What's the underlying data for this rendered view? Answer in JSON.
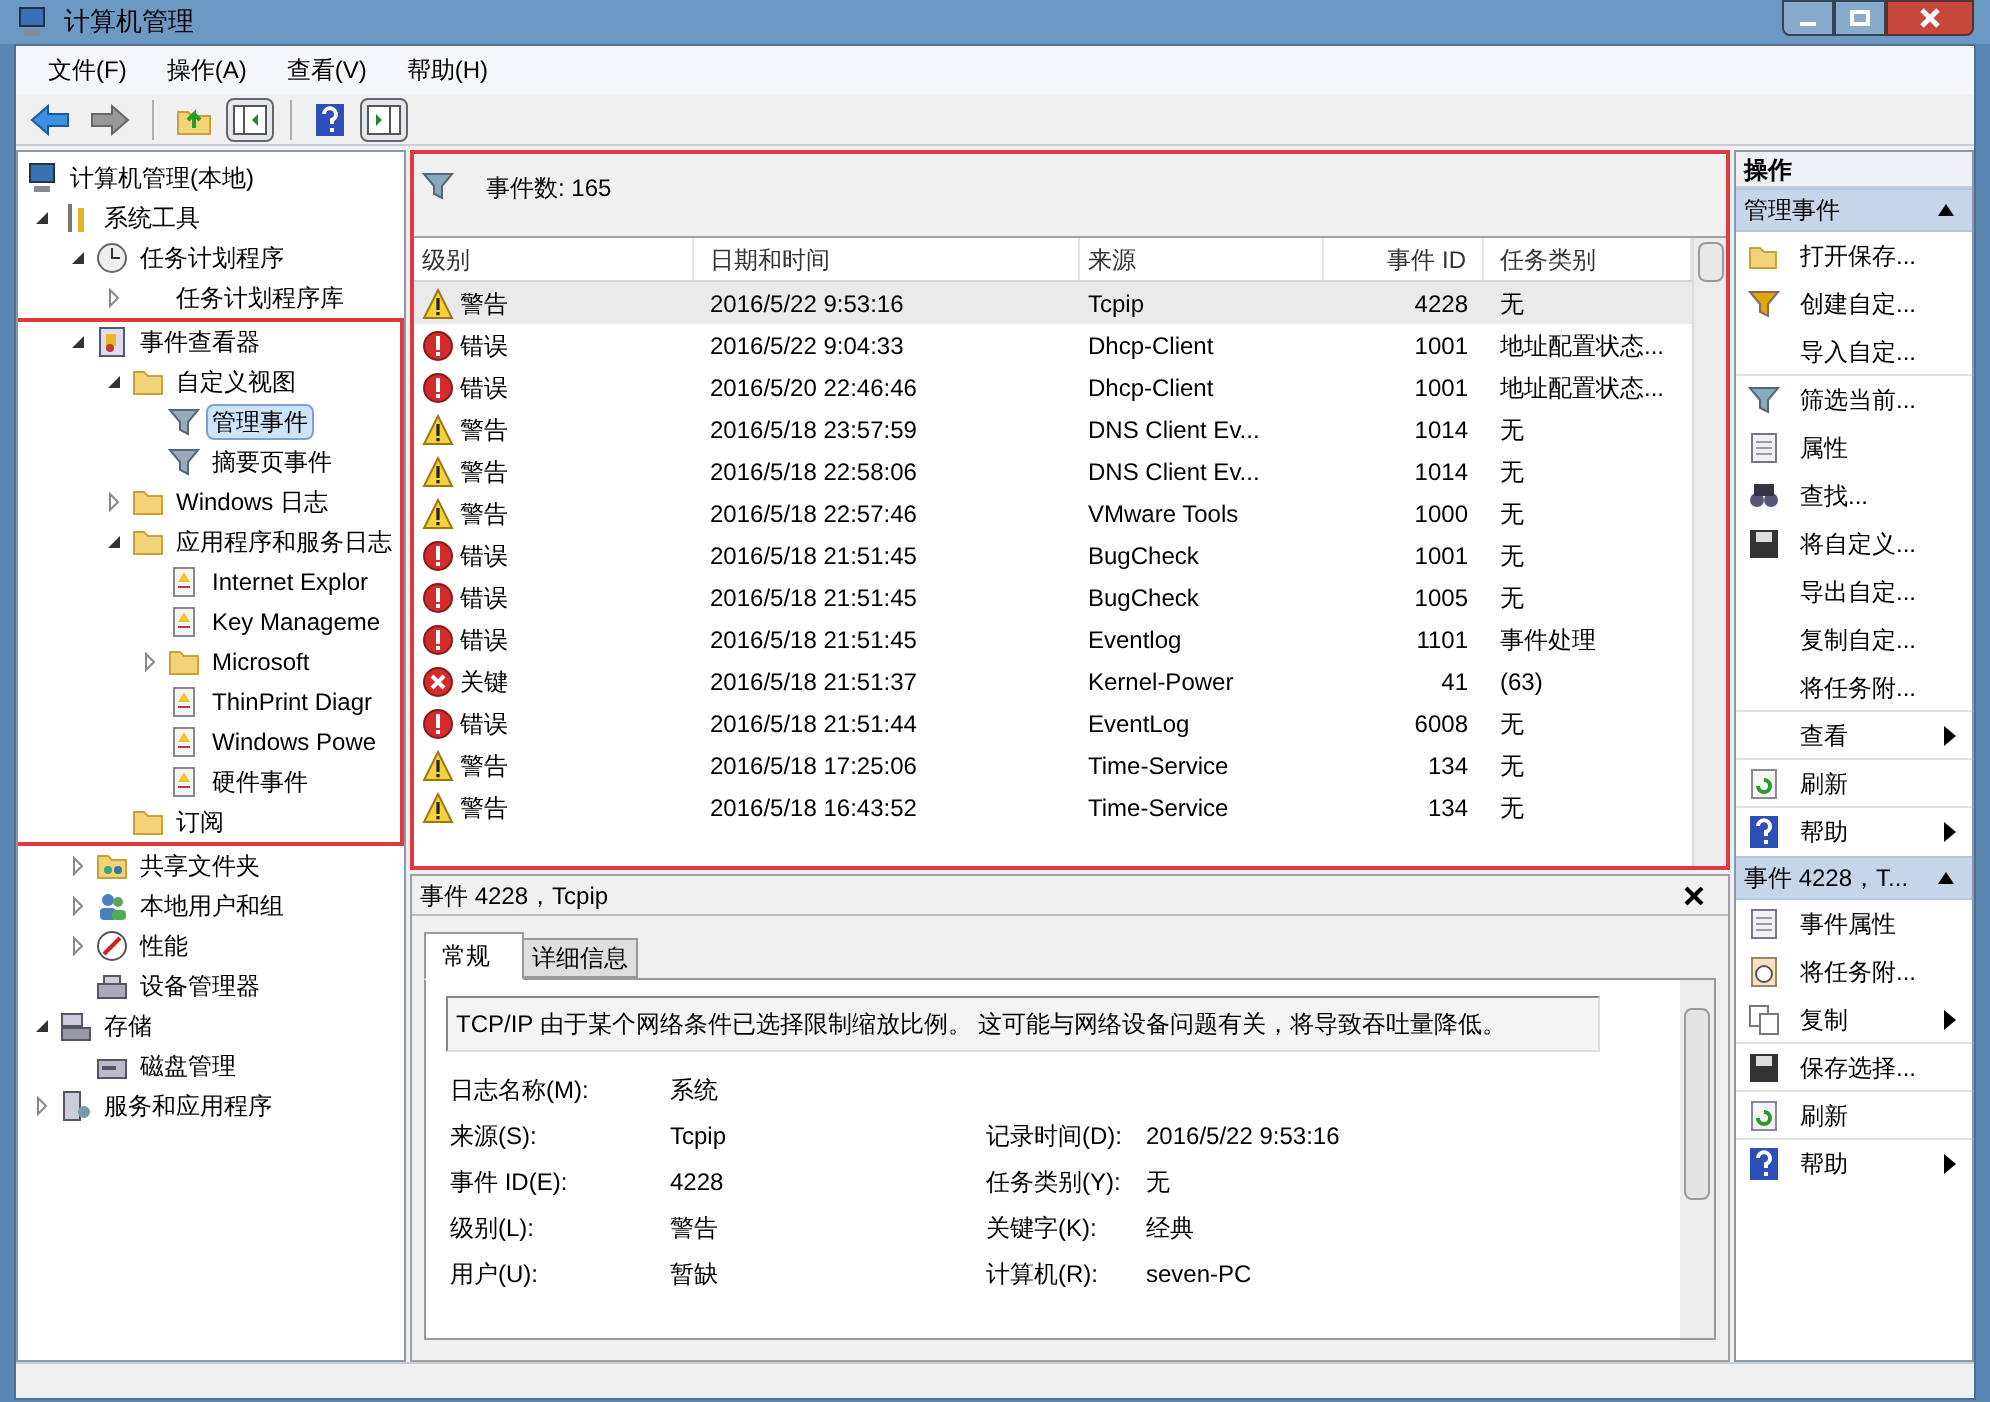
{
  "window": {
    "title": "计算机管理"
  },
  "menu": [
    "文件(F)",
    "操作(A)",
    "查看(V)",
    "帮助(H)"
  ],
  "toolbar": [
    {
      "kind": "back",
      "pressed": false
    },
    {
      "kind": "forward",
      "pressed": false
    },
    {
      "kind": "sep"
    },
    {
      "kind": "up",
      "pressed": false
    },
    {
      "kind": "tree",
      "pressed": true
    },
    {
      "kind": "sep"
    },
    {
      "kind": "help",
      "pressed": false
    },
    {
      "kind": "actions",
      "pressed": true
    }
  ],
  "tree": [
    {
      "label": "计算机管理(本地)",
      "kind": "computer",
      "selected": false,
      "children": [
        {
          "label": "系统工具",
          "kind": "tools",
          "expanded": true,
          "selected": false,
          "children": [
            {
              "label": "任务计划程序",
              "kind": "clock",
              "expanded": true,
              "selected": false,
              "children": [
                {
                  "label": "任务计划程序库",
                  "kind": "none",
                  "expanded": false,
                  "selected": false
                }
              ]
            },
            {
              "label": "事件查看器",
              "kind": "viewer",
              "expanded": true,
              "highlighted": true,
              "selected": false,
              "children": [
                {
                  "label": "自定义视图",
                  "kind": "folder",
                  "expanded": true,
                  "selected": false,
                  "children": [
                    {
                      "label": "管理事件",
                      "kind": "filter",
                      "selected": true
                    },
                    {
                      "label": "摘要页事件",
                      "kind": "filter",
                      "selected": false
                    }
                  ]
                },
                {
                  "label": "Windows 日志",
                  "kind": "folder",
                  "expanded": false,
                  "selected": false
                },
                {
                  "label": "应用程序和服务日志",
                  "kind": "folder",
                  "expanded": true,
                  "selected": false,
                  "children": [
                    {
                      "label": "Internet Explor",
                      "kind": "log",
                      "selected": false
                    },
                    {
                      "label": "Key Manageme",
                      "kind": "log",
                      "selected": false
                    },
                    {
                      "label": "Microsoft",
                      "kind": "folder",
                      "expanded": false,
                      "selected": false
                    },
                    {
                      "label": "ThinPrint Diagr",
                      "kind": "log",
                      "selected": false
                    },
                    {
                      "label": "Windows Powe",
                      "kind": "log",
                      "selected": false
                    },
                    {
                      "label": "硬件事件",
                      "kind": "log",
                      "selected": false
                    }
                  ]
                },
                {
                  "label": "订阅",
                  "kind": "folder",
                  "selected": false
                }
              ]
            },
            {
              "label": "共享文件夹",
              "kind": "share",
              "expanded": false,
              "selected": false
            },
            {
              "label": "本地用户和组",
              "kind": "users",
              "expanded": false,
              "selected": false
            },
            {
              "label": "性能",
              "kind": "perf",
              "expanded": false,
              "selected": false
            },
            {
              "label": "设备管理器",
              "kind": "device",
              "selected": false
            }
          ]
        },
        {
          "label": "存储",
          "kind": "storage",
          "expanded": true,
          "selected": false,
          "children": [
            {
              "label": "磁盘管理",
              "kind": "disk",
              "selected": false
            }
          ]
        },
        {
          "label": "服务和应用程序",
          "kind": "services",
          "expanded": false,
          "selected": false
        }
      ]
    }
  ],
  "events": {
    "highlighted": true,
    "count_label": "事件数: 165",
    "columns": [
      "级别",
      "日期和时间",
      "来源",
      "事件 ID",
      "任务类别"
    ],
    "rows": [
      {
        "kind": "warning",
        "level": "警告",
        "date": "2016/5/22 9:53:16",
        "source": "Tcpip",
        "id": "4228",
        "task": "无",
        "selected": true
      },
      {
        "kind": "error",
        "level": "错误",
        "date": "2016/5/22 9:04:33",
        "source": "Dhcp-Client",
        "id": "1001",
        "task": "地址配置状态...",
        "selected": false
      },
      {
        "kind": "error",
        "level": "错误",
        "date": "2016/5/20 22:46:46",
        "source": "Dhcp-Client",
        "id": "1001",
        "task": "地址配置状态...",
        "selected": false
      },
      {
        "kind": "warning",
        "level": "警告",
        "date": "2016/5/18 23:57:59",
        "source": "DNS Client Ev...",
        "id": "1014",
        "task": "无",
        "selected": false
      },
      {
        "kind": "warning",
        "level": "警告",
        "date": "2016/5/18 22:58:06",
        "source": "DNS Client Ev...",
        "id": "1014",
        "task": "无",
        "selected": false
      },
      {
        "kind": "warning",
        "level": "警告",
        "date": "2016/5/18 22:57:46",
        "source": "VMware Tools",
        "id": "1000",
        "task": "无",
        "selected": false
      },
      {
        "kind": "error",
        "level": "错误",
        "date": "2016/5/18 21:51:45",
        "source": "BugCheck",
        "id": "1001",
        "task": "无",
        "selected": false
      },
      {
        "kind": "error",
        "level": "错误",
        "date": "2016/5/18 21:51:45",
        "source": "BugCheck",
        "id": "1005",
        "task": "无",
        "selected": false
      },
      {
        "kind": "error",
        "level": "错误",
        "date": "2016/5/18 21:51:45",
        "source": "Eventlog",
        "id": "1101",
        "task": "事件处理",
        "selected": false
      },
      {
        "kind": "critical",
        "level": "关键",
        "date": "2016/5/18 21:51:37",
        "source": "Kernel-Power",
        "id": "41",
        "task": "(63)",
        "selected": false
      },
      {
        "kind": "error",
        "level": "错误",
        "date": "2016/5/18 21:51:44",
        "source": "EventLog",
        "id": "6008",
        "task": "无",
        "selected": false
      },
      {
        "kind": "warning",
        "level": "警告",
        "date": "2016/5/18 17:25:06",
        "source": "Time-Service",
        "id": "134",
        "task": "无",
        "selected": false
      },
      {
        "kind": "warning",
        "level": "警告",
        "date": "2016/5/18 16:43:52",
        "source": "Time-Service",
        "id": "134",
        "task": "无",
        "selected": false
      }
    ]
  },
  "detail": {
    "title": "事件 4228，Tcpip",
    "tabs": [
      {
        "label": "常规",
        "selected": true
      },
      {
        "label": "详细信息",
        "selected": false
      }
    ],
    "message": "TCP/IP 由于某个网络条件已选择限制缩放比例。 这可能与网络设备问题有关，将导致吞吐量降低。",
    "fields": [
      [
        {
          "label": "日志名称(M):",
          "value": "系统"
        }
      ],
      [
        {
          "label": "来源(S):",
          "value": "Tcpip"
        },
        {
          "label": "记录时间(D):",
          "value": "2016/5/22 9:53:16"
        }
      ],
      [
        {
          "label": "事件 ID(E):",
          "value": "4228"
        },
        {
          "label": "任务类别(Y):",
          "value": "无"
        }
      ],
      [
        {
          "label": "级别(L):",
          "value": "警告"
        },
        {
          "label": "关键字(K):",
          "value": "经典"
        }
      ],
      [
        {
          "label": "用户(U):",
          "value": "暂缺"
        },
        {
          "label": "计算机(R):",
          "value": "seven-PC"
        }
      ]
    ]
  },
  "actions": {
    "title": "操作",
    "sections": [
      {
        "title": "管理事件",
        "expanded": true,
        "items": [
          {
            "label": "打开保存...",
            "kind": "open",
            "submenu": false,
            "divider": false
          },
          {
            "label": "创建自定...",
            "kind": "create",
            "submenu": false,
            "divider": false
          },
          {
            "label": "导入自定...",
            "kind": "none",
            "submenu": false,
            "divider": true
          },
          {
            "label": "筛选当前...",
            "kind": "filter",
            "submenu": false,
            "divider": false
          },
          {
            "label": "属性",
            "kind": "props",
            "submenu": false,
            "divider": false
          },
          {
            "label": "查找...",
            "kind": "find",
            "submenu": false,
            "divider": false
          },
          {
            "label": "将自定义...",
            "kind": "save",
            "submenu": false,
            "divider": false
          },
          {
            "label": "导出自定...",
            "kind": "none",
            "submenu": false,
            "divider": false
          },
          {
            "label": "复制自定...",
            "kind": "none",
            "submenu": false,
            "divider": false
          },
          {
            "label": "将任务附...",
            "kind": "none",
            "submenu": false,
            "divider": true
          },
          {
            "label": "查看",
            "kind": "none",
            "submenu": true,
            "divider": true
          },
          {
            "label": "刷新",
            "kind": "refresh",
            "submenu": false,
            "divider": true
          },
          {
            "label": "帮助",
            "kind": "help",
            "submenu": true,
            "divider": false
          }
        ]
      },
      {
        "title": "事件 4228，T...",
        "expanded": true,
        "items": [
          {
            "label": "事件属性",
            "kind": "props",
            "submenu": false,
            "divider": false
          },
          {
            "label": "将任务附...",
            "kind": "task",
            "submenu": false,
            "divider": false
          },
          {
            "label": "复制",
            "kind": "copy",
            "submenu": true,
            "divider": true
          },
          {
            "label": "保存选择...",
            "kind": "save",
            "submenu": false,
            "divider": true
          },
          {
            "label": "刷新",
            "kind": "refresh",
            "submenu": false,
            "divider": true
          },
          {
            "label": "帮助",
            "kind": "help",
            "submenu": true,
            "divider": false
          }
        ]
      }
    ]
  }
}
